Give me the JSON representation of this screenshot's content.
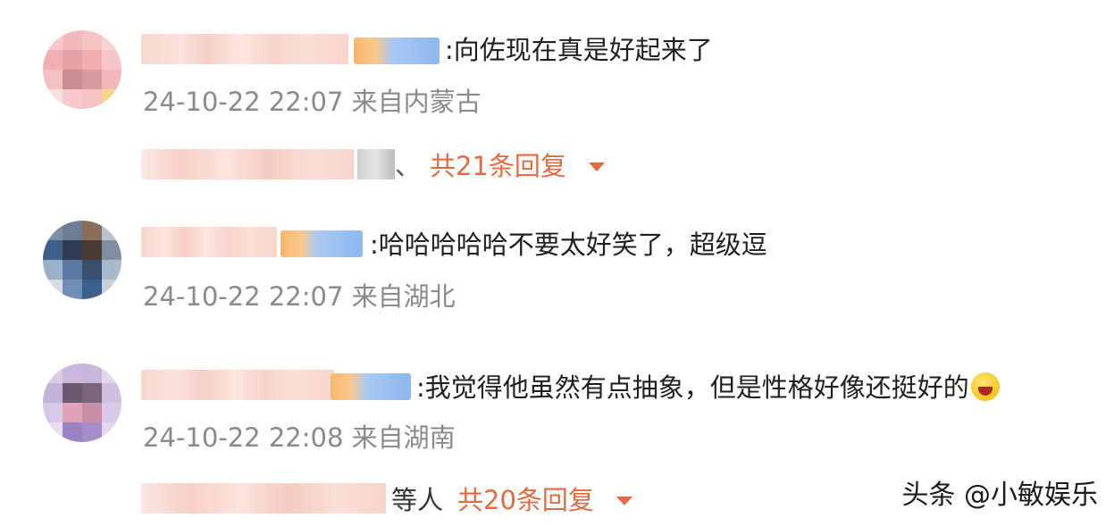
{
  "comments": [
    {
      "text": ":向佐现在真是好起来了",
      "timestamp": "24-10-22 22:07",
      "location": "来自内蒙古",
      "replies": {
        "separator": "、",
        "count_label": "共21条回复"
      }
    },
    {
      "text": ":哈哈哈哈哈不要太好笑了，超级逗",
      "timestamp": "24-10-22 22:07",
      "location": "来自湖北"
    },
    {
      "text": ":我觉得他虽然有点抽象，但是性格好像还挺好的",
      "emoji": "laughing-emoji",
      "timestamp": "24-10-22 22:08",
      "location": "来自湖南",
      "replies": {
        "others_label": "等人",
        "count_label": "共20条回复"
      }
    }
  ],
  "colors": {
    "accent": "#e8693f",
    "meta": "#8a8a8a",
    "text": "#1f1f1f"
  },
  "icons": {
    "expand": "chevron-down-icon"
  },
  "watermark": "头条 @小敏娱乐"
}
